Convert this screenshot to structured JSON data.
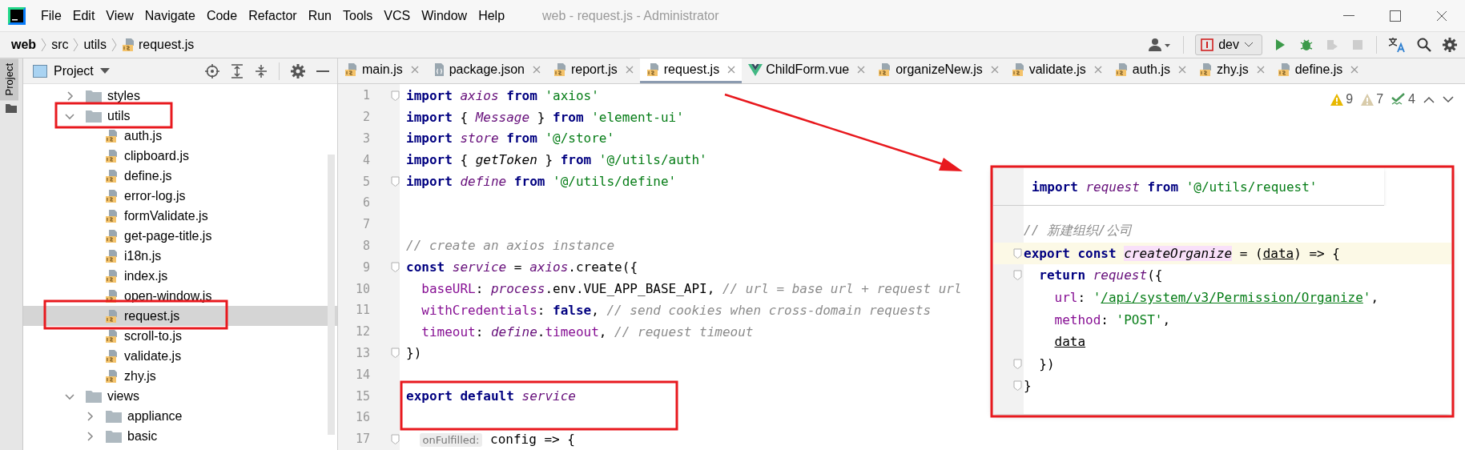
{
  "menu": [
    "File",
    "Edit",
    "View",
    "Navigate",
    "Code",
    "Refactor",
    "Run",
    "Tools",
    "VCS",
    "Window",
    "Help"
  ],
  "window": {
    "title": "web - request.js - Administrator"
  },
  "breadcrumbs": [
    {
      "text": "web",
      "kind": "project"
    },
    {
      "text": "src",
      "kind": "folder"
    },
    {
      "text": "utils",
      "kind": "folder"
    },
    {
      "text": "request.js",
      "kind": "js"
    }
  ],
  "toolbar": {
    "run_config": "dev",
    "actions": [
      {
        "kind": "run",
        "disabled": false
      },
      {
        "kind": "debug",
        "disabled": false
      },
      {
        "kind": "coverage",
        "disabled": true
      },
      {
        "kind": "stop",
        "disabled": true
      }
    ]
  },
  "tool_stripe": {
    "label": "Project",
    "selected": true
  },
  "project": {
    "title": "Project",
    "tree": [
      {
        "label": "styles",
        "kind": "folder",
        "expanded": false,
        "selected": false
      },
      {
        "label": "utils",
        "kind": "folder",
        "expanded": true,
        "selected": false,
        "children": [
          {
            "label": "auth.js",
            "kind": "js",
            "selected": false
          },
          {
            "label": "clipboard.js",
            "kind": "js",
            "selected": false
          },
          {
            "label": "define.js",
            "kind": "js",
            "selected": false
          },
          {
            "label": "error-log.js",
            "kind": "js",
            "selected": false
          },
          {
            "label": "formValidate.js",
            "kind": "js",
            "selected": false
          },
          {
            "label": "get-page-title.js",
            "kind": "js",
            "selected": false
          },
          {
            "label": "i18n.js",
            "kind": "js",
            "selected": false
          },
          {
            "label": "index.js",
            "kind": "js",
            "selected": false
          },
          {
            "label": "open-window.js",
            "kind": "js",
            "selected": false
          },
          {
            "label": "request.js",
            "kind": "js",
            "selected": true
          },
          {
            "label": "scroll-to.js",
            "kind": "js",
            "selected": false
          },
          {
            "label": "validate.js",
            "kind": "js",
            "selected": false
          },
          {
            "label": "zhy.js",
            "kind": "js",
            "selected": false
          }
        ]
      },
      {
        "label": "views",
        "kind": "folder",
        "expanded": true,
        "selected": false,
        "children": [
          {
            "label": "appliance",
            "kind": "folder",
            "expanded": false,
            "selected": false
          },
          {
            "label": "basic",
            "kind": "folder",
            "expanded": false,
            "selected": false
          }
        ]
      }
    ]
  },
  "tabs": [
    {
      "label": "main.js",
      "kind": "js",
      "selected": false
    },
    {
      "label": "package.json",
      "kind": "json",
      "selected": false
    },
    {
      "label": "report.js",
      "kind": "js",
      "selected": false
    },
    {
      "label": "request.js",
      "kind": "js",
      "selected": true
    },
    {
      "label": "ChildForm.vue",
      "kind": "vue",
      "selected": false
    },
    {
      "label": "organizeNew.js",
      "kind": "js",
      "selected": false
    },
    {
      "label": "validate.js",
      "kind": "js",
      "selected": false
    },
    {
      "label": "auth.js",
      "kind": "js",
      "selected": false
    },
    {
      "label": "zhy.js",
      "kind": "js",
      "selected": false
    },
    {
      "label": "define.js",
      "kind": "js",
      "selected": false
    }
  ],
  "inspections": {
    "warnings": "9",
    "weak_warnings": "7",
    "typos": "4"
  },
  "editor": {
    "lines": [
      {
        "number": "1",
        "fold": true,
        "tokens": [
          {
            "kind": "kw",
            "text": "import "
          },
          {
            "kind": "var",
            "text": "axios"
          },
          {
            "kind": "kw",
            "text": " from "
          },
          {
            "kind": "str",
            "text": "'axios'"
          }
        ]
      },
      {
        "number": "2",
        "fold": false,
        "tokens": [
          {
            "kind": "kw",
            "text": "import "
          },
          {
            "kind": "plain",
            "text": "{ "
          },
          {
            "kind": "var",
            "text": "Message"
          },
          {
            "kind": "plain",
            "text": " } "
          },
          {
            "kind": "kw",
            "text": "from "
          },
          {
            "kind": "str",
            "text": "'element-ui'"
          }
        ]
      },
      {
        "number": "3",
        "fold": false,
        "tokens": [
          {
            "kind": "kw",
            "text": "import "
          },
          {
            "kind": "var",
            "text": "store"
          },
          {
            "kind": "kw",
            "text": " from "
          },
          {
            "kind": "str",
            "text": "'@/store'"
          }
        ]
      },
      {
        "number": "4",
        "fold": false,
        "tokens": [
          {
            "kind": "kw",
            "text": "import "
          },
          {
            "kind": "plain",
            "text": "{ "
          },
          {
            "kind": "fn",
            "text": "getToken"
          },
          {
            "kind": "plain",
            "text": " } "
          },
          {
            "kind": "kw",
            "text": "from "
          },
          {
            "kind": "str",
            "text": "'@/utils/auth'"
          }
        ]
      },
      {
        "number": "5",
        "fold": true,
        "tokens": [
          {
            "kind": "kw",
            "text": "import "
          },
          {
            "kind": "var",
            "text": "define"
          },
          {
            "kind": "kw",
            "text": " from "
          },
          {
            "kind": "str",
            "text": "'@/utils/define'"
          }
        ]
      },
      {
        "number": "6",
        "fold": false
      },
      {
        "number": "7",
        "fold": false
      },
      {
        "number": "8",
        "fold": false,
        "tokens": [
          {
            "kind": "cmt",
            "text": "// create an axios instance"
          }
        ]
      },
      {
        "number": "9",
        "fold": true,
        "tokens": [
          {
            "kind": "kw",
            "text": "const "
          },
          {
            "kind": "var",
            "text": "service"
          },
          {
            "kind": "plain",
            "text": " = "
          },
          {
            "kind": "var",
            "text": "axios"
          },
          {
            "kind": "plain",
            "text": ".create({"
          }
        ]
      },
      {
        "number": "10",
        "fold": false,
        "tokens": [
          {
            "kind": "prop",
            "text": "  baseURL"
          },
          {
            "kind": "plain",
            "text": ": "
          },
          {
            "kind": "var",
            "text": "process"
          },
          {
            "kind": "plain",
            "text": ".env.VUE_APP_BASE_API, "
          },
          {
            "kind": "cmt",
            "text": "// url = base url + request url"
          }
        ]
      },
      {
        "number": "11",
        "fold": false,
        "tokens": [
          {
            "kind": "prop",
            "text": "  withCredentials"
          },
          {
            "kind": "plain",
            "text": ": "
          },
          {
            "kind": "kw",
            "text": "false"
          },
          {
            "kind": "plain",
            "text": ", "
          },
          {
            "kind": "cmt",
            "text": "// send cookies when cross-domain requests"
          }
        ]
      },
      {
        "number": "12",
        "fold": false,
        "tokens": [
          {
            "kind": "prop",
            "text": "  timeout"
          },
          {
            "kind": "plain",
            "text": ": "
          },
          {
            "kind": "var",
            "text": "define"
          },
          {
            "kind": "plain",
            "text": "."
          },
          {
            "kind": "prop",
            "text": "timeout"
          },
          {
            "kind": "plain",
            "text": ", "
          },
          {
            "kind": "cmt",
            "text": "// request timeout"
          }
        ]
      },
      {
        "number": "13",
        "fold": true,
        "tokens": [
          {
            "kind": "plain",
            "text": "})"
          }
        ]
      },
      {
        "number": "14",
        "fold": false
      },
      {
        "number": "15",
        "fold": false,
        "tokens": [
          {
            "kind": "kw",
            "text": "export default "
          },
          {
            "kind": "var",
            "text": "service"
          }
        ]
      },
      {
        "number": "16",
        "fold": false
      },
      {
        "number": "17",
        "fold": true,
        "tokens": [
          {
            "kind": "hint",
            "text": "onFulfilled:"
          },
          {
            "kind": "plain",
            "text": " config => {"
          }
        ]
      }
    ]
  },
  "popup": {
    "header": [
      {
        "kind": "kw",
        "text": "import "
      },
      {
        "kind": "var",
        "text": "request"
      },
      {
        "kind": "kw",
        "text": " from "
      },
      {
        "kind": "str",
        "text": "'@/utils/request'"
      }
    ],
    "lines": [
      {
        "fold": false,
        "current": false,
        "tokens": [
          {
            "kind": "cmt",
            "text": "// 新建组织/公司"
          }
        ]
      },
      {
        "fold": true,
        "current": true,
        "tokens": [
          {
            "kind": "kw",
            "text": "export const "
          },
          {
            "kind": "decl",
            "text": "createOrganize"
          },
          {
            "kind": "plain",
            "text": " = ("
          },
          {
            "kind": "under",
            "text": "data"
          },
          {
            "kind": "plain",
            "text": ") => {"
          }
        ]
      },
      {
        "fold": true,
        "current": false,
        "tokens": [
          {
            "kind": "kw",
            "text": "  return "
          },
          {
            "kind": "var",
            "text": "request"
          },
          {
            "kind": "plain",
            "text": "({"
          }
        ]
      },
      {
        "fold": false,
        "current": false,
        "tokens": [
          {
            "kind": "prop",
            "text": "    url"
          },
          {
            "kind": "plain",
            "text": ": "
          },
          {
            "kind": "str",
            "text": "'"
          },
          {
            "kind": "link",
            "text": "/api/system/v3/Permission/Organize"
          },
          {
            "kind": "str",
            "text": "'"
          },
          {
            "kind": "plain",
            "text": ","
          }
        ]
      },
      {
        "fold": false,
        "current": false,
        "tokens": [
          {
            "kind": "prop",
            "text": "    method"
          },
          {
            "kind": "plain",
            "text": ": "
          },
          {
            "kind": "str",
            "text": "'POST'"
          },
          {
            "kind": "plain",
            "text": ","
          }
        ]
      },
      {
        "fold": false,
        "current": false,
        "tokens": [
          {
            "kind": "under",
            "text": "    data"
          }
        ]
      },
      {
        "fold": true,
        "current": false,
        "tokens": [
          {
            "kind": "plain",
            "text": "  })"
          }
        ]
      },
      {
        "fold": true,
        "current": false,
        "tokens": [
          {
            "kind": "plain",
            "text": "}"
          }
        ]
      }
    ]
  }
}
